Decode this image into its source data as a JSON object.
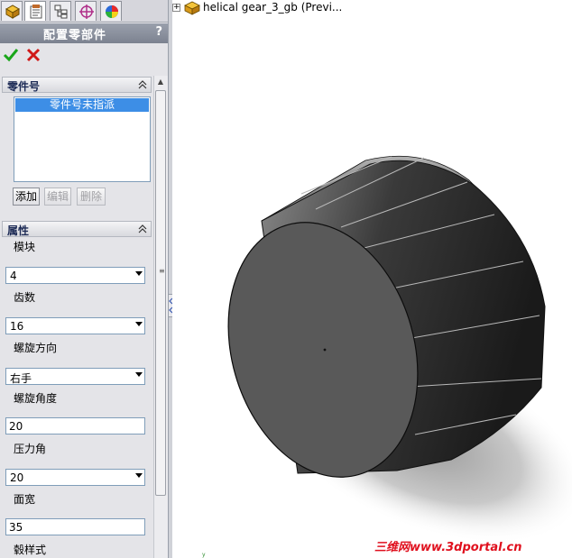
{
  "property_manager": {
    "title": "配置零部件",
    "help": "?",
    "sections": {
      "part_number": {
        "title": "零件号",
        "list_items": [
          "零件号未指派"
        ],
        "buttons": {
          "add": "添加",
          "edit": "编辑",
          "delete": "删除"
        }
      },
      "properties": {
        "title": "属性",
        "fields": [
          {
            "label": "模块",
            "value": "4",
            "kind": "combo"
          },
          {
            "label": "齿数",
            "value": "16",
            "kind": "combo"
          },
          {
            "label": "螺旋方向",
            "value": "右手",
            "kind": "combo"
          },
          {
            "label": "螺旋角度",
            "value": "20",
            "kind": "text"
          },
          {
            "label": "压力角",
            "value": "20",
            "kind": "combo"
          },
          {
            "label": "面宽",
            "value": "35",
            "kind": "text"
          },
          {
            "label": "毂样式",
            "value": "",
            "kind": "label"
          }
        ]
      }
    }
  },
  "viewport": {
    "tree_label": "helical gear_3_gb  (Previ...",
    "watermark": "三维网www.3dportal.cn"
  },
  "colors": {
    "selection": "#3d8ee6",
    "title_bar": "#8a909c",
    "ok": "#1aa61a",
    "cancel": "#d01818",
    "watermark": "#e0101e"
  },
  "icons": [
    "feature-manager-icon",
    "property-manager-icon",
    "configuration-manager-icon",
    "dimxpert-icon",
    "display-manager-icon",
    "ok-check-icon",
    "cancel-x-icon",
    "collapse-chevron-icon",
    "part-icon"
  ]
}
